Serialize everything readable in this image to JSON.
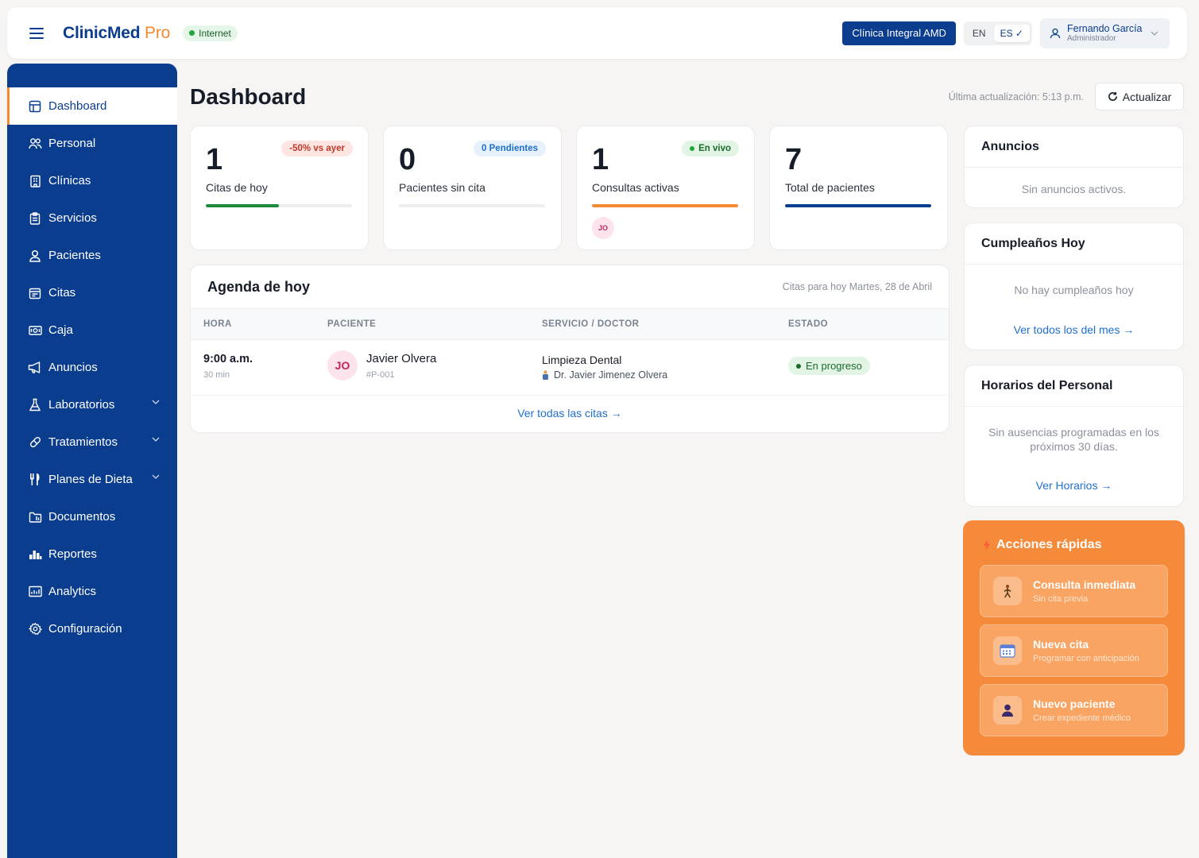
{
  "topbar": {
    "brand_main": "ClinicMed",
    "brand_accent": "Pro",
    "connection": "Internet",
    "clinic": "Clínica Integral AMD",
    "lang_en": "EN",
    "lang_es": "ES ✓",
    "user_name": "Fernando García",
    "user_role": "Administrador"
  },
  "sidebar": {
    "items": [
      {
        "label": "Dashboard",
        "icon": "dashboard-icon"
      },
      {
        "label": "Personal",
        "icon": "staff-icon"
      },
      {
        "label": "Clínicas",
        "icon": "building-icon"
      },
      {
        "label": "Servicios",
        "icon": "clipboard-icon"
      },
      {
        "label": "Pacientes",
        "icon": "user-icon"
      },
      {
        "label": "Citas",
        "icon": "calendar-icon"
      },
      {
        "label": "Caja",
        "icon": "cash-icon"
      },
      {
        "label": "Anuncios",
        "icon": "megaphone-icon"
      },
      {
        "label": "Laboratorios",
        "icon": "flask-icon"
      },
      {
        "label": "Tratamientos",
        "icon": "pill-icon"
      },
      {
        "label": "Planes de Dieta",
        "icon": "utensils-icon"
      },
      {
        "label": "Documentos",
        "icon": "folder-icon"
      },
      {
        "label": "Reportes",
        "icon": "bar-chart-icon"
      },
      {
        "label": "Analytics",
        "icon": "analytics-icon"
      },
      {
        "label": "Configuración",
        "icon": "gear-icon"
      }
    ]
  },
  "main": {
    "title": "Dashboard",
    "updated": "Última actualización: 5:13 p.m.",
    "refresh": "Actualizar"
  },
  "stats": [
    {
      "value": "1",
      "label": "Citas de hoy",
      "badge": "-50% vs ayer",
      "progress": 0.5,
      "bar_color": "#1f8a3b"
    },
    {
      "value": "0",
      "label": "Pacientes sin cita",
      "badge": "0 Pendientes",
      "progress": 0,
      "bar_color": "#9aa0aa"
    },
    {
      "value": "1",
      "label": "Consultas activas",
      "badge": "En vivo",
      "progress": 1,
      "bar_color": "#f58a2f",
      "avatar": "JO"
    },
    {
      "value": "7",
      "label": "Total de pacientes",
      "badge": "",
      "progress": 1,
      "bar_color": "#0b3d8f"
    }
  ],
  "agenda": {
    "title": "Agenda de hoy",
    "subtitle": "Citas para hoy Martes, 28 de Abril",
    "columns": [
      "HORA",
      "PACIENTE",
      "SERVICIO / DOCTOR",
      "ESTADO"
    ],
    "rows": [
      {
        "hora": "9:00 a.m.",
        "duracion": "30 min",
        "initials": "JO",
        "paciente": "Javier Olvera",
        "id": "#P-001",
        "servicio": "Limpieza Dental",
        "doctor": "Dr. Javier Jimenez Olvera",
        "estado": "En progreso"
      }
    ],
    "link": "Ver todas las citas →"
  },
  "anuncios": {
    "title": "Anuncios",
    "empty": "Sin anuncios activos."
  },
  "cumpleanos": {
    "title": "Cumpleaños Hoy",
    "empty": "No hay cumpleaños hoy",
    "link": "Ver todos los del mes →"
  },
  "horarios": {
    "title": "Horarios del Personal",
    "empty": "Sin ausencias programadas en los próximos 30 días.",
    "link": "Ver Horarios →"
  },
  "quick": {
    "title": "Acciones rápidas",
    "actions": [
      {
        "title": "Consulta inmediata",
        "subtitle": "Sin cita previa",
        "icon": "walking-person-icon"
      },
      {
        "title": "Nueva cita",
        "subtitle": "Programar con anticipación",
        "icon": "calendar-icon"
      },
      {
        "title": "Nuevo paciente",
        "subtitle": "Crear expediente médico",
        "icon": "patient-icon"
      }
    ]
  },
  "colors": {
    "primary": "#0b3d8f",
    "accent": "#f58a2f",
    "success": "#1f8a3b",
    "link": "#1f6fd1"
  }
}
